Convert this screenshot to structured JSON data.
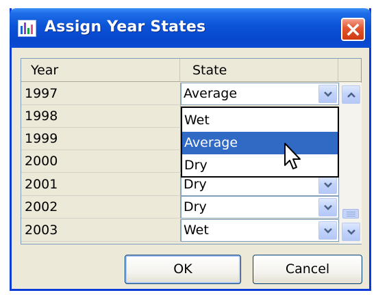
{
  "window": {
    "title": "Assign Year States"
  },
  "table": {
    "columns": [
      "Year",
      "State"
    ],
    "rows": [
      {
        "year": "1997",
        "state": "Average"
      },
      {
        "year": "1998",
        "state": ""
      },
      {
        "year": "1999",
        "state": ""
      },
      {
        "year": "2000",
        "state": ""
      },
      {
        "year": "2001",
        "state": "Dry"
      },
      {
        "year": "2002",
        "state": "Dry"
      },
      {
        "year": "2003",
        "state": "Wet"
      }
    ]
  },
  "dropdown": {
    "options": [
      "Wet",
      "Average",
      "Dry"
    ],
    "highlighted": "Average"
  },
  "buttons": {
    "ok": "OK",
    "cancel": "Cancel"
  },
  "colors": {
    "title_bar": "#0a53d7",
    "selection": "#316ac5",
    "close": "#e2552f"
  },
  "icons": [
    "app-chart-icon",
    "close-icon",
    "chevron-down-icon",
    "scroll-up-icon",
    "scroll-down-icon",
    "mouse-pointer-icon"
  ]
}
